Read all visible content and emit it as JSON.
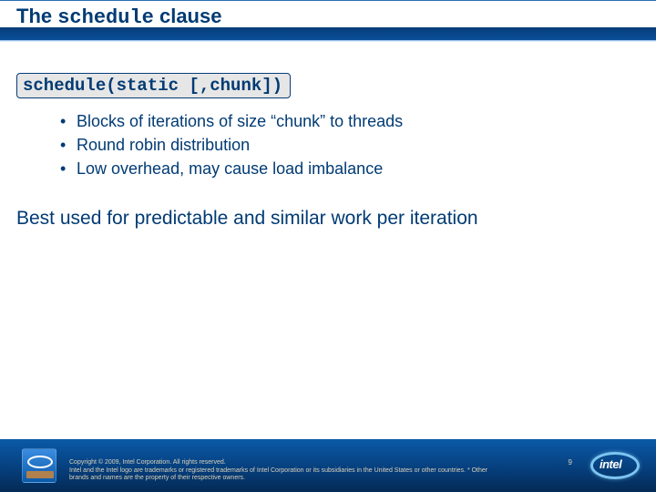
{
  "title": {
    "prefix": "The ",
    "code": "schedule",
    "suffix": " clause"
  },
  "schedule_box": "schedule(static [,chunk])",
  "bullets": [
    "Blocks of iterations of size “chunk” to threads",
    "Round robin distribution",
    "Low overhead, may cause load imbalance"
  ],
  "best_used": "Best used for predictable and similar work per iteration",
  "footer": {
    "copyright_line1": "Copyright © 2009, Intel Corporation. All rights reserved.",
    "copyright_line2": "Intel and the Intel logo are trademarks or registered trademarks of Intel Corporation or its subsidiaries in the United States or other countries. * Other brands and names are the property of their respective owners.",
    "page_number": "9",
    "logo_text": "intel"
  }
}
